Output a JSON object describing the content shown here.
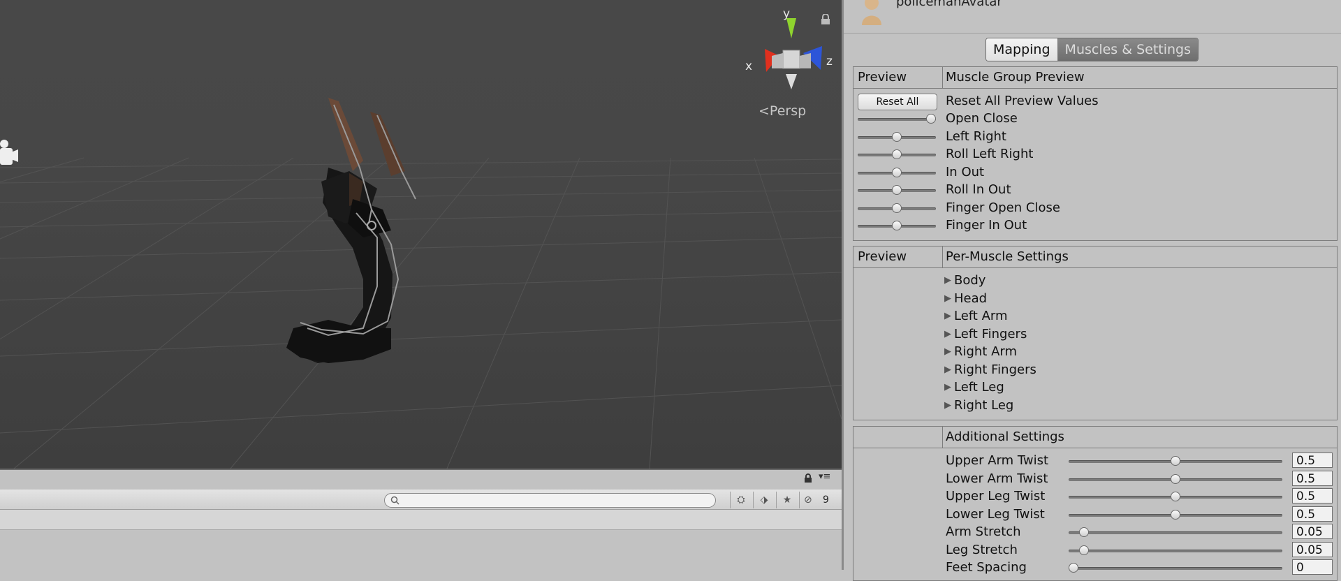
{
  "scene": {
    "gizmo": {
      "y_label": "y",
      "x_label": "x",
      "z_label": "z"
    },
    "projection_label": "Persp",
    "colors": {
      "x_axis": "#e0301e",
      "y_axis": "#8fd42e",
      "z_axis": "#2d55d8"
    }
  },
  "bottom_bar": {
    "search_placeholder": "",
    "hidden_count": "9"
  },
  "inspector": {
    "title": "policemanAvatar",
    "tabs": [
      {
        "label": "Mapping",
        "active": true
      },
      {
        "label": "Muscles & Settings",
        "active": false
      }
    ],
    "muscle_group_preview": {
      "col1": "Preview",
      "col2": "Muscle Group Preview",
      "reset_button": "Reset All",
      "reset_label": "Reset All Preview Values",
      "sliders": [
        {
          "label": "Open Close",
          "value": 1.0
        },
        {
          "label": "Left Right",
          "value": 0.5
        },
        {
          "label": "Roll Left Right",
          "value": 0.5
        },
        {
          "label": "In Out",
          "value": 0.5
        },
        {
          "label": "Roll In Out",
          "value": 0.5
        },
        {
          "label": "Finger Open Close",
          "value": 0.5
        },
        {
          "label": "Finger In Out",
          "value": 0.5
        }
      ]
    },
    "per_muscle": {
      "col1": "Preview",
      "col2": "Per-Muscle Settings",
      "groups": [
        "Body",
        "Head",
        "Left Arm",
        "Left Fingers",
        "Right Arm",
        "Right Fingers",
        "Left Leg",
        "Right Leg"
      ]
    },
    "additional": {
      "col2": "Additional Settings",
      "settings": [
        {
          "label": "Upper Arm Twist",
          "value": "0.5",
          "fraction": 0.5
        },
        {
          "label": "Lower Arm Twist",
          "value": "0.5",
          "fraction": 0.5
        },
        {
          "label": "Upper Leg Twist",
          "value": "0.5",
          "fraction": 0.5
        },
        {
          "label": "Lower Leg Twist",
          "value": "0.5",
          "fraction": 0.5
        },
        {
          "label": "Arm Stretch",
          "value": "0.05",
          "fraction": 0.05
        },
        {
          "label": "Leg Stretch",
          "value": "0.05",
          "fraction": 0.05
        },
        {
          "label": "Feet Spacing",
          "value": "0",
          "fraction": 0.0
        }
      ]
    }
  }
}
